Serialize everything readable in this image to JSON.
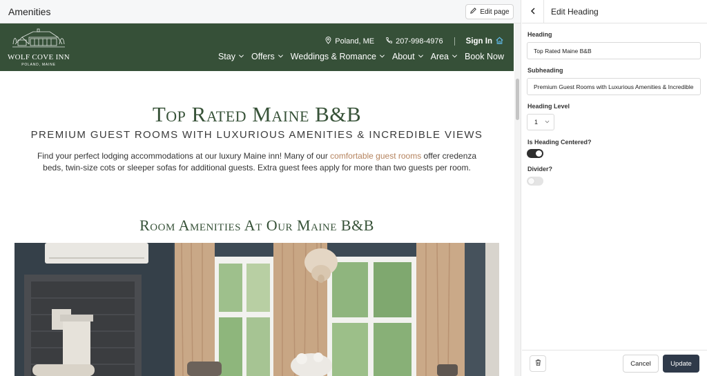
{
  "editor": {
    "page_title": "Amenities",
    "edit_page_label": "Edit page"
  },
  "site": {
    "logo": {
      "name": "WOLF COVE INN",
      "location": "POLAND, MAINE"
    },
    "header": {
      "location": "Poland, ME",
      "phone": "207-998-4976",
      "sign_in": "Sign In"
    },
    "nav": [
      {
        "label": "Stay",
        "has_dropdown": true
      },
      {
        "label": "Offers",
        "has_dropdown": true
      },
      {
        "label": "Weddings & Romance",
        "has_dropdown": true
      },
      {
        "label": "About",
        "has_dropdown": true
      },
      {
        "label": "Area",
        "has_dropdown": true
      },
      {
        "label": "Book Now",
        "has_dropdown": false
      }
    ],
    "hero": {
      "heading": "Top Rated Maine B&B",
      "subheading": "PREMIUM GUEST ROOMS WITH LUXURIOUS AMENITIES & INCREDIBLE VIEWS",
      "body_before": "Find your perfect lodging accommodations at our luxury Maine inn! Many of our ",
      "body_link": "comfortable guest rooms",
      "body_after": " offer credenza beds, twin-size cots or sleeper sofas for additional guests. Extra guest fees apply for more than two guests per room."
    },
    "amenities_heading": "Room Amenities At Our Maine B&B"
  },
  "panel": {
    "title": "Edit Heading",
    "heading_label": "Heading",
    "heading_value": "Top Rated Maine B&B",
    "subheading_label": "Subheading",
    "subheading_value": "Premium Guest Rooms with Luxurious Amenities & Incredible Views",
    "level_label": "Heading Level",
    "level_value": "1",
    "centered_label": "Is Heading Centered?",
    "centered_on": true,
    "divider_label": "Divider?",
    "divider_on": false,
    "cancel_label": "Cancel",
    "update_label": "Update"
  },
  "colors": {
    "header_green": "#365038",
    "heading_green": "#375238",
    "link_tan": "#b5835e",
    "update_button": "#2f3a4a"
  },
  "icons": [
    "pencil-icon",
    "map-pin-icon",
    "phone-icon",
    "home-icon",
    "chevron-down-icon",
    "back-arrow-icon",
    "trash-icon"
  ]
}
